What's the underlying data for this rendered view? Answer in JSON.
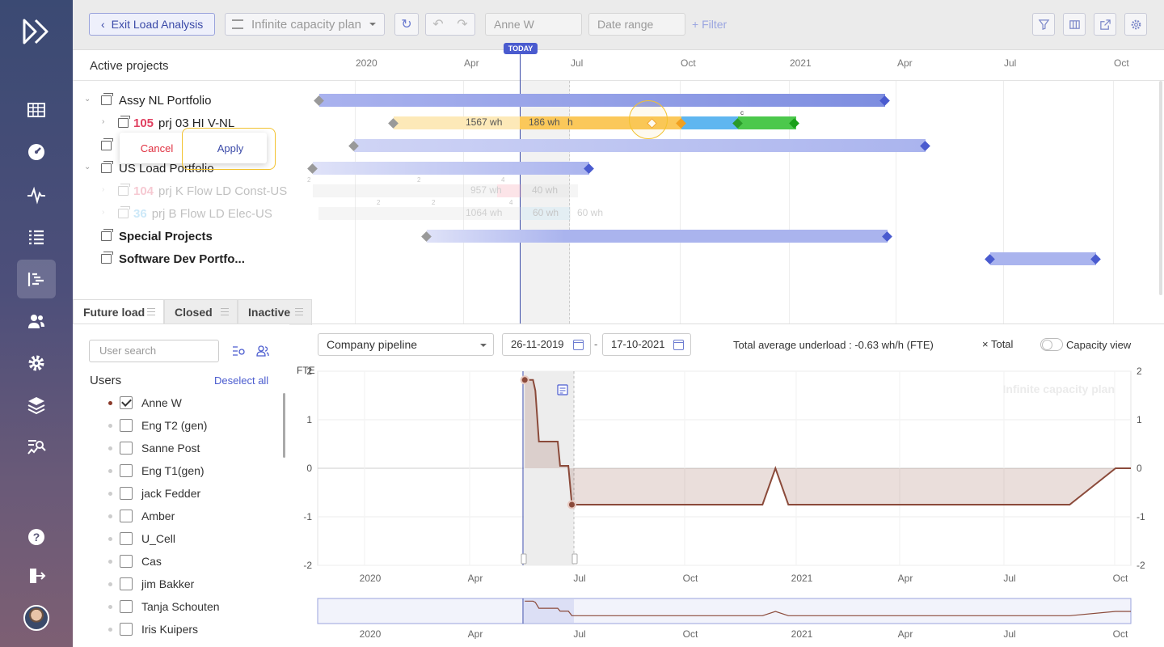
{
  "toolbar": {
    "exit_label": "Exit Load Analysis",
    "plan_label": "Infinite capacity plan",
    "user_placeholder": "Anne W",
    "date_placeholder": "Date range",
    "filter_label": "+ Filter"
  },
  "gantt": {
    "title": "Active projects",
    "today_label": "TODAY",
    "ticks": [
      "2020",
      "Apr",
      "Jul",
      "Oct",
      "2021",
      "Apr",
      "Jul",
      "Oct"
    ],
    "rows": [
      {
        "label": "Assy NL Portfolio"
      },
      {
        "num": "105",
        "label": "prj 03 HI V-NL",
        "wh1": "1567 wh",
        "wh2": "186 wh",
        "wh3": "h"
      },
      {
        "label": ""
      },
      {
        "label": "US Load Portfolio"
      },
      {
        "num": "104",
        "label": "prj K Flow LD Const-US",
        "wh1": "957 wh",
        "wh2": "40 wh"
      },
      {
        "num": "36",
        "label": "prj B Flow LD Elec-US",
        "wh1": "1064 wh",
        "wh2": "60 wh",
        "wh3": "60 wh"
      },
      {
        "label": "Special Projects"
      },
      {
        "label": "Software Dev Portfo..."
      }
    ],
    "small_marks": [
      "2",
      "2",
      "4",
      "2",
      "2",
      "4",
      "c"
    ]
  },
  "popup": {
    "cancel_label": "Cancel",
    "apply_label": "Apply"
  },
  "tabs": [
    {
      "label": "Future load"
    },
    {
      "label": "Closed"
    },
    {
      "label": "Inactive"
    }
  ],
  "users": {
    "search_placeholder": "User search",
    "title": "Users",
    "deselect_label": "Deselect all",
    "list": [
      {
        "name": "Anne W",
        "checked": true
      },
      {
        "name": "Eng T2 (gen)",
        "checked": false
      },
      {
        "name": "Sanne Post",
        "checked": false
      },
      {
        "name": "Eng T1(gen)",
        "checked": false
      },
      {
        "name": "jack Fedder",
        "checked": false
      },
      {
        "name": "Amber",
        "checked": false
      },
      {
        "name": "U_Cell",
        "checked": false
      },
      {
        "name": "Cas",
        "checked": false
      },
      {
        "name": "jim Bakker",
        "checked": false
      },
      {
        "name": "Tanja Schouten",
        "checked": false
      },
      {
        "name": "Iris Kuipers",
        "checked": false
      }
    ]
  },
  "chart_controls": {
    "pipeline": "Company pipeline",
    "date_from": "26-11-2019",
    "date_sep": "-",
    "date_to": "17-10-2021",
    "summary": "Total average underload : -0.63 wh/h (FTE)",
    "total_legend": "× Total",
    "capacity_label": "Capacity view"
  },
  "colors": {
    "accent": "#4a5bcf",
    "load": "#8b4a3a",
    "warn": "#f2c230"
  },
  "chart_data": {
    "type": "area",
    "ylabel": "FTE",
    "watermark": "Infinite capacity plan",
    "ylim": [
      -2,
      2
    ],
    "yticks": [
      2,
      1,
      0,
      -1,
      -2
    ],
    "xticks": [
      "2020",
      "Apr",
      "Jul",
      "Oct",
      "2021",
      "Apr",
      "Jul",
      "Oct"
    ],
    "x_domain": [
      "2019-11-26",
      "2021-10-17"
    ],
    "series": [
      {
        "points": [
          [
            "2020-05-20",
            1.82
          ],
          [
            "2020-05-27",
            1.82
          ],
          [
            "2020-05-29",
            1.6
          ],
          [
            "2020-06-01",
            0.55
          ],
          [
            "2020-06-17",
            0.55
          ],
          [
            "2020-06-19",
            0.05
          ],
          [
            "2020-06-26",
            0.05
          ],
          [
            "2020-06-29",
            -0.75
          ],
          [
            "2020-12-08",
            -0.75
          ],
          [
            "2020-12-19",
            0.0
          ],
          [
            "2020-12-30",
            -0.75
          ],
          [
            "2021-08-26",
            -0.75
          ],
          [
            "2021-10-04",
            0.0
          ],
          [
            "2021-10-17",
            0.0
          ]
        ]
      }
    ]
  }
}
